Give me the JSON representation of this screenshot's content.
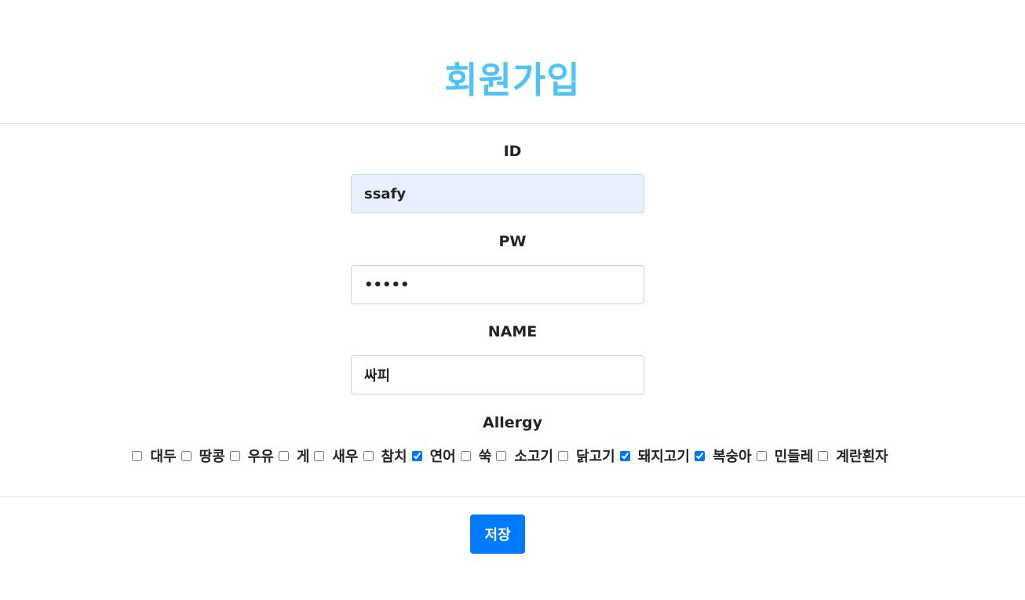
{
  "page_title": "회원가입",
  "form": {
    "id_label": "ID",
    "id_value": "ssafy",
    "pw_label": "PW",
    "pw_value": "12345",
    "name_label": "NAME",
    "name_value": "싸피",
    "allergy_label": "Allergy",
    "allergies": [
      {
        "label": "대두",
        "checked": false
      },
      {
        "label": "땅콩",
        "checked": false
      },
      {
        "label": "우유",
        "checked": false
      },
      {
        "label": "게",
        "checked": false
      },
      {
        "label": "새우",
        "checked": false
      },
      {
        "label": "참치",
        "checked": false
      },
      {
        "label": "연어",
        "checked": true
      },
      {
        "label": "쑥",
        "checked": false
      },
      {
        "label": "소고기",
        "checked": false
      },
      {
        "label": "닭고기",
        "checked": false
      },
      {
        "label": "돼지고기",
        "checked": true
      },
      {
        "label": "복숭아",
        "checked": true
      },
      {
        "label": "민들레",
        "checked": false
      },
      {
        "label": "계란흰자",
        "checked": false
      }
    ]
  },
  "save_label": "저장",
  "colors": {
    "title": "#4fc3f7",
    "button": "#007bff",
    "autofill": "#e8f0fe"
  }
}
